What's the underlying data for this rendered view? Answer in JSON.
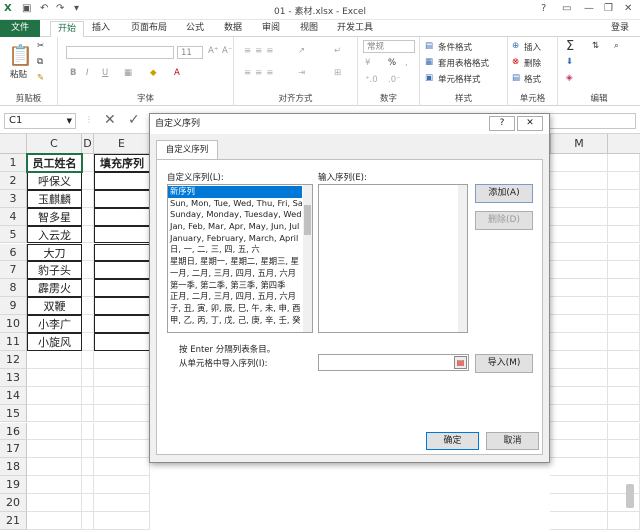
{
  "window": {
    "title": "01 - 素材.xlsx - Excel",
    "help": "?",
    "minimize": "—",
    "restore": "❐",
    "close": "✕"
  },
  "ribbon_tabs": [
    {
      "label": "文件"
    },
    {
      "label": "开始"
    },
    {
      "label": "插入"
    },
    {
      "label": "页面布局"
    },
    {
      "label": "公式"
    },
    {
      "label": "数据"
    },
    {
      "label": "审阅"
    },
    {
      "label": "视图"
    },
    {
      "label": "开发工具"
    }
  ],
  "login": "登录",
  "ribbon": {
    "paste": "粘贴",
    "clipboard_label": "剪贴板",
    "font_label": "字体",
    "font_size": "11",
    "bold": "B",
    "italic": "I",
    "underline": "U",
    "align_label": "对齐方式",
    "number_format": "常规",
    "percent": "%",
    "comma": ",",
    "number_label": "数字",
    "cond_format": "条件格式",
    "table_format": "套用表格格式",
    "cell_style": "单元格样式",
    "style_label": "样式",
    "insert": "插入",
    "delete": "删除",
    "format": "格式",
    "cells_label": "单元格",
    "edit_label": "编辑"
  },
  "formula_bar": {
    "name_box": "C1",
    "cancel": "✕",
    "enter": "✓"
  },
  "columns": [
    {
      "label": "C"
    },
    {
      "label": "D"
    },
    {
      "label": "E"
    },
    {
      "label": "M"
    }
  ],
  "rows": [
    "1",
    "2",
    "3",
    "4",
    "5",
    "6",
    "7",
    "8",
    "9",
    "10",
    "11",
    "12",
    "13",
    "14",
    "15",
    "16",
    "17",
    "18",
    "19",
    "20",
    "21"
  ],
  "sheet": {
    "header_c": "员工姓名",
    "header_e": "填充序列",
    "names": [
      "呼保义",
      "玉麒麟",
      "智多星",
      "入云龙",
      "大刀",
      "豹子头",
      "霹雳火",
      "双鞭",
      "小李广",
      "小旋风"
    ]
  },
  "dialog": {
    "title": "自定义序列",
    "tab": "自定义序列",
    "list_label": "自定义序列(L):",
    "input_label": "输入序列(E):",
    "add_button": "添加(A)",
    "delete_button": "删除(D)",
    "hint": "按 Enter 分隔列表条目。",
    "import_label": "从单元格中导入序列(I):",
    "import_button": "导入(M)",
    "ok_button": "确定",
    "cancel_button": "取消",
    "help": "?",
    "close": "✕",
    "list_items": [
      "新序列",
      "Sun, Mon, Tue, Wed, Thu, Fri, Sat",
      "Sunday, Monday, Tuesday, Wednesday",
      "Jan, Feb, Mar, Apr, May, Jun, Jul",
      "January, February, March, April",
      "日, 一, 二, 三, 四, 五, 六",
      "星期日, 星期一, 星期二, 星期三, 星",
      "一月, 二月, 三月, 四月, 五月, 六月",
      "第一季, 第二季, 第三季, 第四季",
      "正月, 二月, 三月, 四月, 五月, 六月",
      "子, 丑, 寅, 卯, 辰, 巳, 午, 未, 申, 酉",
      "甲, 乙, 丙, 丁, 戊, 己, 庚, 辛, 壬, 癸"
    ]
  },
  "colors": {
    "excel_green": "#217346",
    "selection": "#0078d7"
  }
}
